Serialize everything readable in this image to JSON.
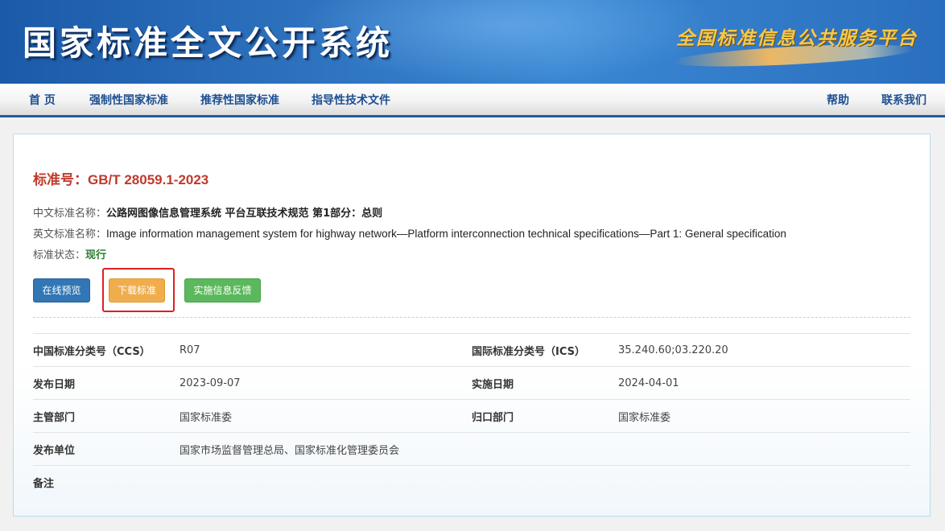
{
  "header": {
    "site_title": "国家标准全文公开系统",
    "slogan": "全国标准信息公共服务平台"
  },
  "nav": {
    "home": "首 页",
    "mandatory": "强制性国家标准",
    "recommended": "推荐性国家标准",
    "guidance": "指导性技术文件",
    "help": "帮助",
    "contact": "联系我们"
  },
  "standard": {
    "number_label": "标准号：",
    "number": "GB/T 28059.1-2023",
    "cn_name_label": "中文标准名称：",
    "cn_name": "公路网图像信息管理系统 平台互联技术规范 第1部分：总则",
    "en_name_label": "英文标准名称：",
    "en_name": "Image information management system for highway network—Platform interconnection technical specifications—Part 1: General specification",
    "status_label": "标准状态：",
    "status": "现行"
  },
  "buttons": {
    "preview": "在线预览",
    "download": "下载标准",
    "feedback": "实施信息反馈"
  },
  "meta": {
    "ccs_label": "中国标准分类号（CCS）",
    "ccs": "R07",
    "ics_label": "国际标准分类号（ICS）",
    "ics": "35.240.60;03.220.20",
    "publish_date_label": "发布日期",
    "publish_date": "2023-09-07",
    "effective_date_label": "实施日期",
    "effective_date": "2024-04-01",
    "authority_label": "主管部门",
    "authority": "国家标准委",
    "owner_label": "归口部门",
    "owner": "国家标准委",
    "publisher_label": "发布单位",
    "publisher": "国家市场监督管理总局、国家标准化管理委员会",
    "remark_label": "备注",
    "remark": ""
  },
  "colors": {
    "banner_blue": "#2f74c0",
    "nav_text": "#1d4f91",
    "title_red": "#c0392b",
    "status_green": "#2e7d32",
    "btn_preview": "#3276b5",
    "btn_download": "#f0ad4e",
    "btn_feedback": "#5cb85c",
    "highlight": "#e02020"
  }
}
